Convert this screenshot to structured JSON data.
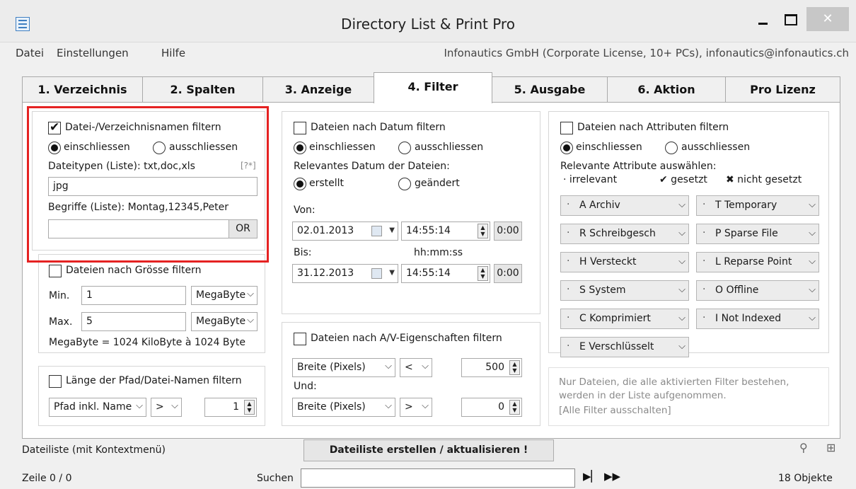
{
  "window": {
    "title": "Directory List & Print Pro",
    "minimize": "",
    "maximize": "",
    "close": "✕"
  },
  "menu": {
    "items": [
      "Datei",
      "Einstellungen",
      "Hilfe"
    ],
    "license": "Infonautics GmbH (Corporate License, 10+ PCs), infonautics@infonautics.ch"
  },
  "tabs": [
    "1. Verzeichnis",
    "2. Spalten",
    "3. Anzeige",
    "4. Filter",
    "5. Ausgabe",
    "6. Aktion",
    "Pro Lizenz"
  ],
  "active_tab": "4. Filter",
  "name_filter": {
    "checkbox_label": "Datei-/Verzeichnisnamen filtern",
    "include": "einschliessen",
    "exclude": "ausschliessen",
    "types_label": "Dateitypen (Liste): txt,doc,xls",
    "help": "[?*]",
    "types_value": "jpg",
    "terms_label": "Begriffe (Liste): Montag,12345,Peter",
    "terms_value": "",
    "or_button": "OR"
  },
  "size_filter": {
    "checkbox_label": "Dateien nach Grösse filtern",
    "min_label": "Min.",
    "min_value": "1",
    "min_unit": "MegaByte",
    "max_label": "Max.",
    "max_value": "5",
    "max_unit": "MegaByte",
    "note": "MegaByte = 1024 KiloByte à 1024 Byte"
  },
  "length_filter": {
    "checkbox_label": "Länge der Pfad/Datei-Namen filtern",
    "mode": "Pfad inkl. Name",
    "op": ">",
    "value": "1"
  },
  "date_filter": {
    "checkbox_label": "Dateien nach Datum filtern",
    "include": "einschliessen",
    "exclude": "ausschliessen",
    "relevant_label": "Relevantes Datum der Dateien:",
    "created": "erstellt",
    "modified": "geändert",
    "from_label": "Von:",
    "from_date": "02.01.2013",
    "from_time": "14:55:14",
    "from_zero": "0:00",
    "to_label": "Bis:",
    "time_format": "hh:mm:ss",
    "to_date": "31.12.2013",
    "to_time": "14:55:14",
    "to_zero": "0:00"
  },
  "av_filter": {
    "checkbox_label": "Dateien nach A/V-Eigenschaften filtern",
    "prop1": "Breite (Pixels)",
    "op1": "<",
    "val1": "500",
    "and_label": "Und:",
    "prop2": "Breite (Pixels)",
    "op2": ">",
    "val2": "0"
  },
  "attr_filter": {
    "checkbox_label": "Dateien nach Attributen filtern",
    "include": "einschliessen",
    "exclude": "ausschliessen",
    "relevant_label": "Relevante Attribute auswählen:",
    "legend_irrelevant": "· irrelevant",
    "legend_set": "✔ gesetzt",
    "legend_notset": "✖ nicht gesetzt",
    "left": [
      "A Archiv",
      "R Schreibgesch",
      "H Versteckt",
      "S System",
      "C Komprimiert",
      "E Verschlüsselt"
    ],
    "right": [
      "T Temporary",
      "P Sparse File",
      "L Reparse Point",
      "O Offline",
      "I  Not Indexed"
    ]
  },
  "note": {
    "line1": "Nur Dateien, die alle aktivierten Filter bestehen,",
    "line2": "werden in der Liste aufgenommen.",
    "link": "[Alle Filter ausschalten]"
  },
  "footer": {
    "list_label": "Dateiliste (mit Kontextmenü)",
    "create_button": "Dateiliste erstellen / aktualisieren !",
    "row_label": "Zeile 0 / 0",
    "search_label": "Suchen",
    "search_value": "",
    "count": "18 Objekte"
  }
}
